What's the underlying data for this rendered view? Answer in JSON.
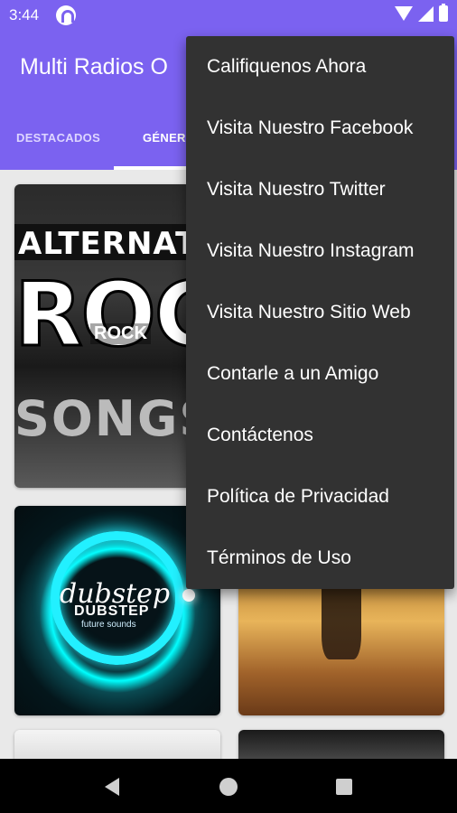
{
  "status_bar": {
    "time": "3:44"
  },
  "app_bar": {
    "title": "Multi Radios O"
  },
  "tabs": [
    {
      "label": "DESTACADOS"
    },
    {
      "label": "GÉNERO"
    }
  ],
  "cards": {
    "rock": {
      "line1": "ALTERNATI",
      "big": "ROCK",
      "label": "ROCK",
      "songs": "SONGS"
    },
    "dubstep": {
      "script": "dubstep",
      "label": "DUBSTEP",
      "sub": "future sounds"
    }
  },
  "menu": {
    "items": [
      {
        "label": "Califiquenos Ahora"
      },
      {
        "label": "Visita Nuestro Facebook"
      },
      {
        "label": "Visita Nuestro Twitter"
      },
      {
        "label": "Visita Nuestro Instagram"
      },
      {
        "label": "Visita Nuestro Sitio Web"
      },
      {
        "label": "Contarle a un Amigo"
      },
      {
        "label": "Contáctenos"
      },
      {
        "label": "Política de Privacidad"
      },
      {
        "label": "Términos de Uso"
      }
    ]
  },
  "colors": {
    "primary": "#7b62f0",
    "menu_bg": "#323232",
    "accent_glow": "#22f0ff"
  },
  "icons": {
    "status": [
      "notification-icon",
      "wifi-icon",
      "signal-icon",
      "battery-icon"
    ],
    "nav": [
      "back-icon",
      "home-icon",
      "recents-icon"
    ]
  }
}
